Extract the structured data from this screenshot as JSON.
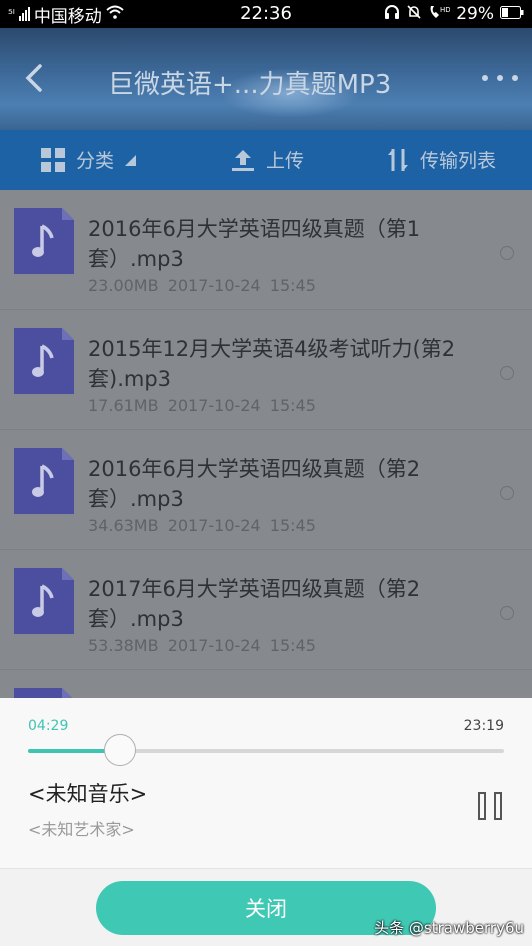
{
  "status_bar": {
    "carrier": "中国移动",
    "time": "22:36",
    "battery": "29%"
  },
  "header": {
    "title": "巨微英语+...力真题MP3"
  },
  "toolbar": {
    "category_label": "分类",
    "upload_label": "上传",
    "transfer_label": "传输列表"
  },
  "files": [
    {
      "name": "2016年6月大学英语四级真题（第1套）.mp3",
      "size": "23.00MB",
      "date": "2017-10-24",
      "time": "15:45"
    },
    {
      "name": "2015年12月大学英语4级考试听力(第2套).mp3",
      "size": "17.61MB",
      "date": "2017-10-24",
      "time": "15:45"
    },
    {
      "name": "2016年6月大学英语四级真题（第2套）.mp3",
      "size": "34.63MB",
      "date": "2017-10-24",
      "time": "15:45"
    },
    {
      "name": "2017年6月大学英语四级真题（第2套）.mp3",
      "size": "53.38MB",
      "date": "2017-10-24",
      "time": "15:45"
    }
  ],
  "player": {
    "current_time": "04:29",
    "total_time": "23:19",
    "progress": 0.193,
    "track_name": "<未知音乐>",
    "artist": "<未知艺术家>",
    "accent_color": "#3fc4b2"
  },
  "bottom": {
    "close_label": "关闭",
    "watermark": "头条 @strawberry6u"
  }
}
